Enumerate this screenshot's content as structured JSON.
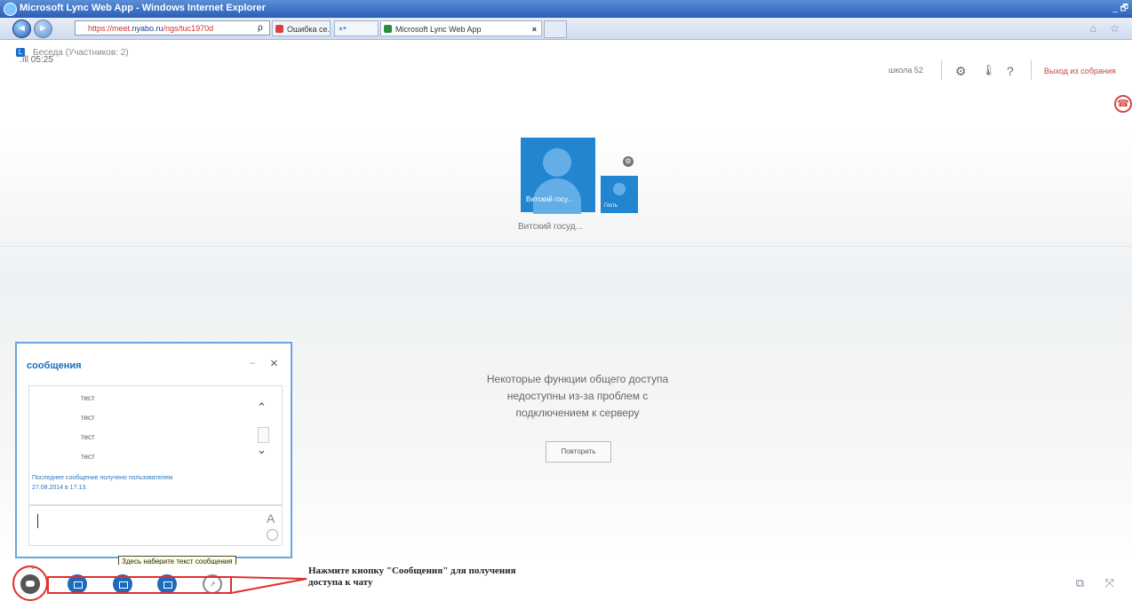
{
  "window": {
    "title": "Microsoft Lync Web App - Windows Internet Explorer",
    "controls": "_ 🗗"
  },
  "browser": {
    "address_prefix": "https://meet.",
    "address_domain": "nyabo.ru",
    "address_suffix": "/ngs/tuc1970d",
    "search_symbol": "ρ",
    "tabs": [
      {
        "label": "Ошибка се...",
        "favicon_color": "#d94040"
      },
      {
        "label": "Microsoft Lync Web App",
        "favicon_color": "#2d8b3e"
      }
    ],
    "tab_close": "×",
    "toolbar_icons": "⌂ ☆"
  },
  "lync": {
    "conversation_title": "Беседа (Участников: 2)",
    "signal_time": ".ıll 05:25",
    "user_name": "школа 52",
    "settings_icon": "⚙",
    "device_icon": "🌡",
    "help_icon": "?",
    "exit_label": "Выход из собрания",
    "hangup_icon": "☎"
  },
  "participants": {
    "big_label": "Витский госу...",
    "small_label": "Гость",
    "name_below": "Витский госуд...",
    "gear": "⚙"
  },
  "notice": {
    "lines": [
      "Некоторые функции общего доступа",
      "недоступны из-за проблем с",
      "подключением к серверу"
    ],
    "retry_label": "Повторить"
  },
  "chat": {
    "title": "сообщения",
    "minimize_icon": "–",
    "close_icon": "×",
    "messages": [
      "тест",
      "тест",
      "тест",
      "тест"
    ],
    "status_line1": "Последнее сообщение получено пользователем",
    "status_line2": "27.08.2014 в 17:13.",
    "font_icon": "A",
    "scroll_up": "⌃",
    "scroll_down": "⌄",
    "tooltip": "Здесь наберите текст сообщения"
  },
  "bottom": {
    "chevron": "⌄",
    "share_icon": "↗",
    "annotation_line1": "Нажмите кнопку \"Сообщения\" для получения",
    "annotation_line2": "доступа к чату",
    "right_icons": "⧉ ⤧"
  },
  "colors": {
    "accent_blue": "#2185d0",
    "highlight_red": "#e03030",
    "chat_border": "#6aa6dd"
  }
}
